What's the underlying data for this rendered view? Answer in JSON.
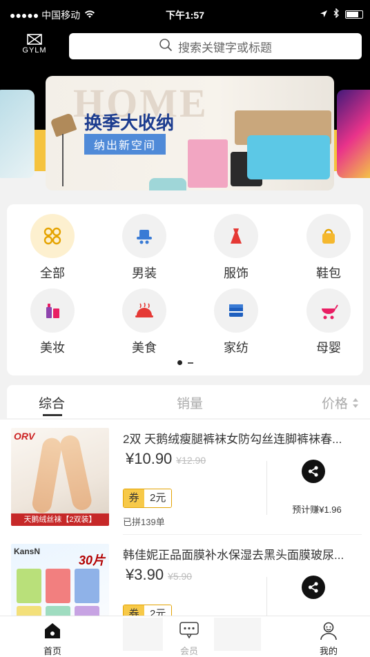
{
  "status_bar": {
    "carrier": "●●●●● 中国移动",
    "time": "下午1:57"
  },
  "header": {
    "logo_text": "GYLM",
    "search_placeholder": "搜索关键字或标题"
  },
  "banner": {
    "big_text": "HOME",
    "title": "换季大收纳",
    "subtitle": "纳出新空间"
  },
  "categories": [
    {
      "label": "全部",
      "icon": "grid-icon"
    },
    {
      "label": "男装",
      "icon": "hat-icon"
    },
    {
      "label": "服饰",
      "icon": "dress-icon"
    },
    {
      "label": "鞋包",
      "icon": "bag-icon"
    },
    {
      "label": "美妆",
      "icon": "cosmetics-icon"
    },
    {
      "label": "美食",
      "icon": "food-dish-icon"
    },
    {
      "label": "家纺",
      "icon": "bed-icon"
    },
    {
      "label": "母婴",
      "icon": "stroller-icon"
    }
  ],
  "sort": {
    "comprehensive": "综合",
    "sales": "销量",
    "price": "价格"
  },
  "products": [
    {
      "title": "2双 天鹅绒瘦腿裤袜女防勾丝连脚裤袜春...",
      "price": "¥10.90",
      "original_price": "¥12.90",
      "coupon_label": "券",
      "coupon_value": "2元",
      "sold": "已拼139单",
      "earn": "预计赚¥1.96",
      "image_brand": "ORV",
      "image_caption": "天鹅绒丝袜【2双装】"
    },
    {
      "title": "韩佳妮正品面膜补水保湿去黑头面膜玻尿...",
      "price": "¥3.90",
      "original_price": "¥5.90",
      "coupon_label": "券",
      "coupon_value": "2元",
      "image_brand": "KansN",
      "image_badge": "30片"
    }
  ],
  "tabbar": {
    "home": "首页",
    "member": "会员",
    "mine": "我的"
  },
  "colors": {
    "accent_yellow": "#f5c33e",
    "header_black": "#000000",
    "coupon_yellow": "#f7c948"
  }
}
